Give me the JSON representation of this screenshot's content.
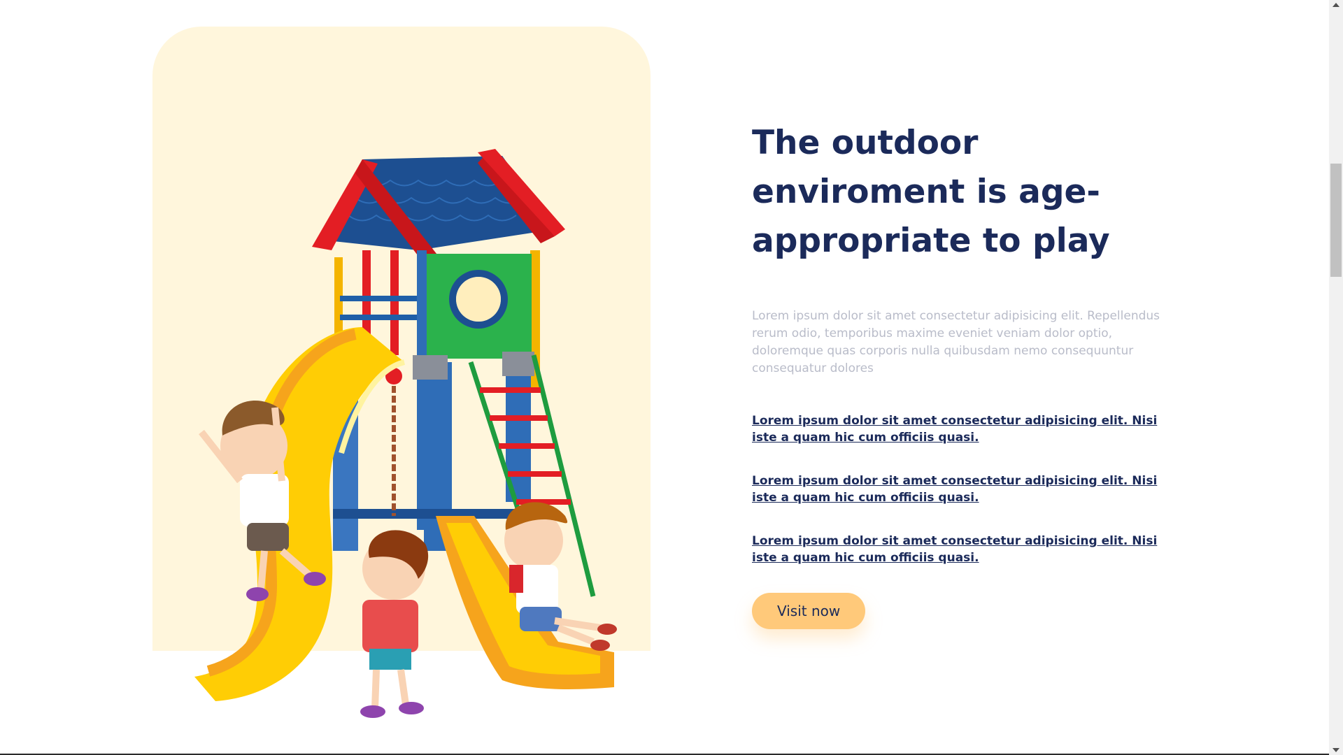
{
  "hero": {
    "title": "The outdoor enviroment is age-appropriate to play",
    "description": "Lorem ipsum dolor sit amet consectetur adipisicing elit. Repellendus rerum odio, temporibus maxime eveniet veniam dolor optio, doloremque quas corporis nulla quibusdam nemo consequuntur consequatur dolores",
    "links": [
      "Lorem ipsum dolor sit amet consectetur adipisicing elit. Nisi iste a quam hic cum officiis quasi.",
      "Lorem ipsum dolor sit amet consectetur adipisicing elit. Nisi iste a quam hic cum officiis quasi.",
      "Lorem ipsum dolor sit amet consectetur adipisicing elit. Nisi iste a quam hic cum officiis quasi."
    ],
    "button_label": "Visit now"
  },
  "colors": {
    "title": "#1b2a5a",
    "description": "#b9bcc9",
    "button": "#ffc97a",
    "hero_background": "#fff6dc"
  },
  "icons": {
    "scroll_up": "chevron-up-icon",
    "scroll_down": "chevron-down-icon"
  }
}
